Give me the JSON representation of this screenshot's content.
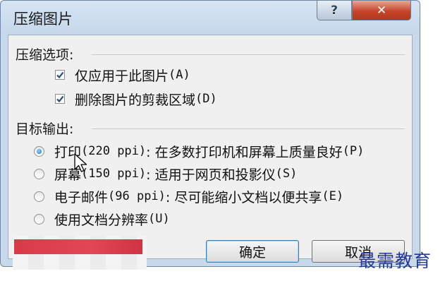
{
  "window": {
    "title": "压缩图片",
    "help_label": "?",
    "close_label": "✕"
  },
  "compress_options": {
    "label": "压缩选项:",
    "items": [
      {
        "label": "仅应用于此图片",
        "shortcut": "(A)",
        "checked": true
      },
      {
        "label": "删除图片的剪裁区域",
        "shortcut": "(D)",
        "checked": true
      }
    ]
  },
  "target_output": {
    "label": "目标输出:",
    "options": [
      {
        "name": "打印",
        "ppi": "(220 ppi)",
        "desc": ": 在多数打印机和屏幕上质量良好",
        "shortcut": "(P)",
        "selected": true
      },
      {
        "name": "屏幕",
        "ppi": "(150 ppi)",
        "desc": ": 适用于网页和投影仪",
        "shortcut": "(S)",
        "selected": false
      },
      {
        "name": "电子邮件",
        "ppi": "(96 ppi)",
        "desc": ": 尽可能缩小文档以便共享",
        "shortcut": "(E)",
        "selected": false
      },
      {
        "name": "使用文档分辨率",
        "ppi": "",
        "desc": "",
        "shortcut": "(U)",
        "selected": false
      }
    ]
  },
  "buttons": {
    "ok_label": "确定",
    "cancel_label": "取消"
  },
  "watermark": "最需教育",
  "colors": {
    "accent": "#1f74c8",
    "close_button": "#c6452b",
    "redaction": "#e24754",
    "watermark": "#243a9d"
  }
}
